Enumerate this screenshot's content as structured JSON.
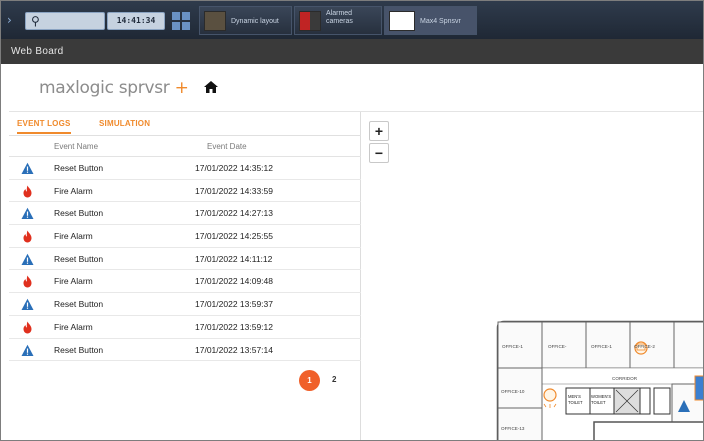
{
  "taskbar": {
    "clock": "14:41:34",
    "apps": [
      {
        "label": "Dynamic layout"
      },
      {
        "label": "Alarmed\ncameras"
      },
      {
        "label": "Max4 Spnsvr"
      }
    ]
  },
  "webboard": {
    "title": "Web Board"
  },
  "header": {
    "logo_main": "maxlogic sprvsr",
    "logo_plus": " +"
  },
  "tabs": [
    {
      "label": "EVENT LOGS"
    },
    {
      "label": "SIMULATION"
    }
  ],
  "table": {
    "columns": [
      "Event Name",
      "Event Date"
    ],
    "rows": [
      {
        "icon": "warning-icon",
        "name": "Reset Button",
        "date": "17/01/2022 14:35:12"
      },
      {
        "icon": "fire-icon",
        "name": "Fire Alarm",
        "date": "17/01/2022 14:33:59"
      },
      {
        "icon": "warning-icon",
        "name": "Reset Button",
        "date": "17/01/2022 14:27:13"
      },
      {
        "icon": "fire-icon",
        "name": "Fire Alarm",
        "date": "17/01/2022 14:25:55"
      },
      {
        "icon": "warning-icon",
        "name": "Reset Button",
        "date": "17/01/2022 14:11:12"
      },
      {
        "icon": "fire-icon",
        "name": "Fire Alarm",
        "date": "17/01/2022 14:09:48"
      },
      {
        "icon": "warning-icon",
        "name": "Reset Button",
        "date": "17/01/2022 13:59:37"
      },
      {
        "icon": "fire-icon",
        "name": "Fire Alarm",
        "date": "17/01/2022 13:59:12"
      },
      {
        "icon": "warning-icon",
        "name": "Reset Button",
        "date": "17/01/2022 13:57:14"
      }
    ]
  },
  "pagination": {
    "current": "1",
    "next": "2"
  },
  "map": {
    "zoom_in": "+",
    "zoom_out": "−",
    "rooms": {
      "office_1": "OFFICE-1",
      "office_2": "OFFICE-",
      "office_3": "OFFICE-1",
      "office_4": "OFFICE-2",
      "office_10": "OFFICE-10",
      "office_13": "OFFICE-13",
      "corridor": "CORRIDOR",
      "mens": "MEN'S",
      "womens": "WOMEN'S",
      "toilet": "TOILET"
    }
  },
  "colors": {
    "accent": "#f08a2c",
    "fire": "#e0301e",
    "warning": "#2a6fb8",
    "page_active": "#f0602a"
  }
}
